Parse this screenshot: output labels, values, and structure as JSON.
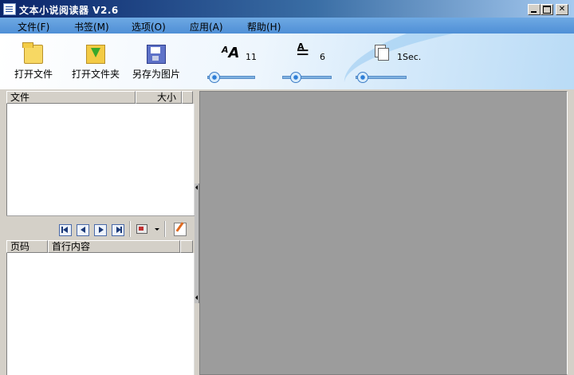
{
  "window": {
    "title": "文本小说阅读器 V2.6"
  },
  "menu": [
    {
      "label": "文件(F)"
    },
    {
      "label": "书签(M)"
    },
    {
      "label": "选项(O)"
    },
    {
      "label": "应用(A)"
    },
    {
      "label": "帮助(H)"
    }
  ],
  "toolbar": {
    "open_file": "打开文件",
    "open_folder": "打开文件夹",
    "save_as_image": "另存为图片"
  },
  "settings": {
    "font_size": {
      "icon": "AA",
      "value": "11",
      "level": 0.1
    },
    "line_spacing": {
      "icon": "A☰",
      "value": "6",
      "level": 0.25
    },
    "page_interval": {
      "icon": "pages-icon",
      "value": "1Sec.",
      "level": 0.0
    }
  },
  "file_list": {
    "columns": [
      "文件",
      "大小"
    ],
    "rows": []
  },
  "page_list": {
    "columns": [
      "页码",
      "首行内容"
    ],
    "rows": []
  },
  "colors": {
    "title_bar": "#0a246a",
    "menu_bar": "#5b9be0",
    "reader_bg": "#9c9c9c",
    "panel_bg": "#d4d0c8"
  }
}
